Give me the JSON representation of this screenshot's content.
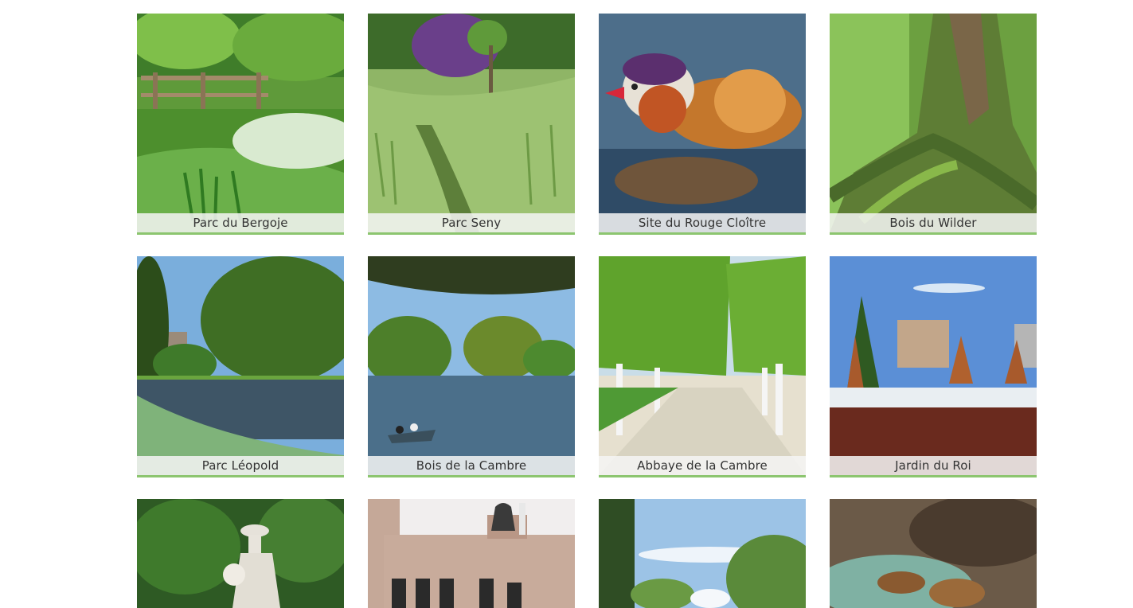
{
  "parks": [
    {
      "name": "Parc du Bergoje",
      "image": "park-bridge-photo"
    },
    {
      "name": "Parc Seny",
      "image": "meadow-stream-photo"
    },
    {
      "name": "Site du Rouge Cloître",
      "image": "mandarin-duck-photo"
    },
    {
      "name": "Bois du Wilder",
      "image": "mossy-tree-roots-photo"
    },
    {
      "name": "Parc Léopold",
      "image": "pond-trees-photo"
    },
    {
      "name": "Bois de la Cambre",
      "image": "lake-rowboat-photo"
    },
    {
      "name": "Abbaye de la Cambre",
      "image": "tree-avenue-photo"
    },
    {
      "name": "Jardin du Roi",
      "image": "snowy-garden-photo"
    },
    {
      "name": "",
      "image": "statue-ivy-photo"
    },
    {
      "name": "",
      "image": "building-bell-photo"
    },
    {
      "name": "",
      "image": "park-fountain-photo"
    },
    {
      "name": "",
      "image": "bronze-sculpture-photo"
    }
  ],
  "colors": {
    "accent": "#8cc56f",
    "caption_bg": "#f5f5f5",
    "caption_text": "#333333"
  }
}
